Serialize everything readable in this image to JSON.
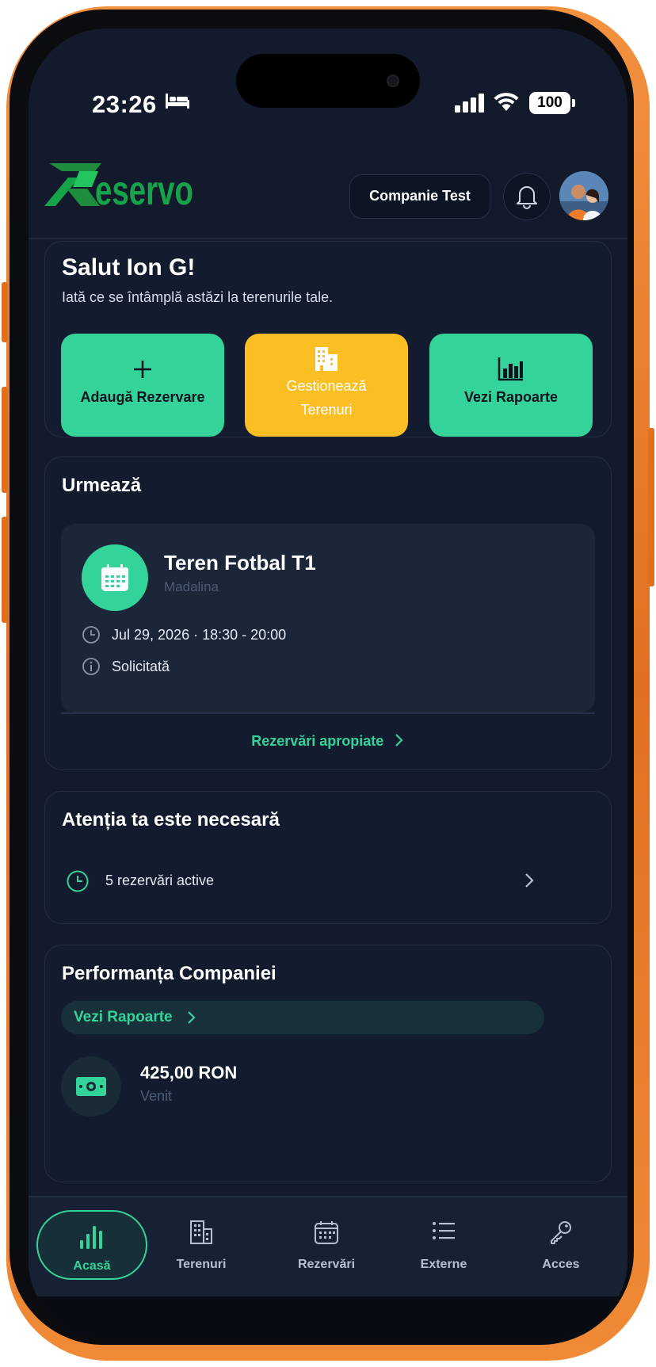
{
  "status_bar": {
    "time": "23:26",
    "battery": "100"
  },
  "header": {
    "logo": "Reservo",
    "company": "Companie Test"
  },
  "welcome": {
    "greeting": "Salut Ion G!",
    "subtitle": "Iată ce se întâmplă astăzi la terenurile tale.",
    "actions": [
      {
        "label": "Adaugă Rezervare",
        "icon": "plus-icon",
        "color": "#34d399"
      },
      {
        "label_line1": "Gestionează",
        "label_line2": "Terenuri",
        "icon": "building-icon",
        "color": "#fbbf24"
      },
      {
        "label": "Vezi Rapoarte",
        "icon": "bar-chart-icon",
        "color": "#34d399"
      }
    ]
  },
  "upcoming": {
    "title": "Urmează",
    "booking": {
      "field": "Teren Fotbal T1",
      "customer": "Madalina",
      "datetime": "Jul 29, 2026 · 18:30 - 20:00",
      "status": "Solicitată"
    },
    "link": "Rezervări apropiate"
  },
  "attention": {
    "title": "Atenția ta este necesară",
    "item": "5 rezervări active"
  },
  "performance": {
    "title": "Performanța Companiei",
    "link": "Vezi Rapoarte",
    "revenue_value": "425,00 RON",
    "revenue_label": "Venit"
  },
  "nav": [
    {
      "label": "Acasă",
      "icon": "bar-chart-icon",
      "active": true
    },
    {
      "label": "Terenuri",
      "icon": "building-icon"
    },
    {
      "label": "Rezervări",
      "icon": "calendar-icon"
    },
    {
      "label": "Externe",
      "icon": "list-icon"
    },
    {
      "label": "Acces",
      "icon": "key-icon"
    }
  ],
  "colors": {
    "accent": "#34d399",
    "warning": "#fbbf24",
    "background": "#121a2b",
    "card": "#131c2e"
  }
}
